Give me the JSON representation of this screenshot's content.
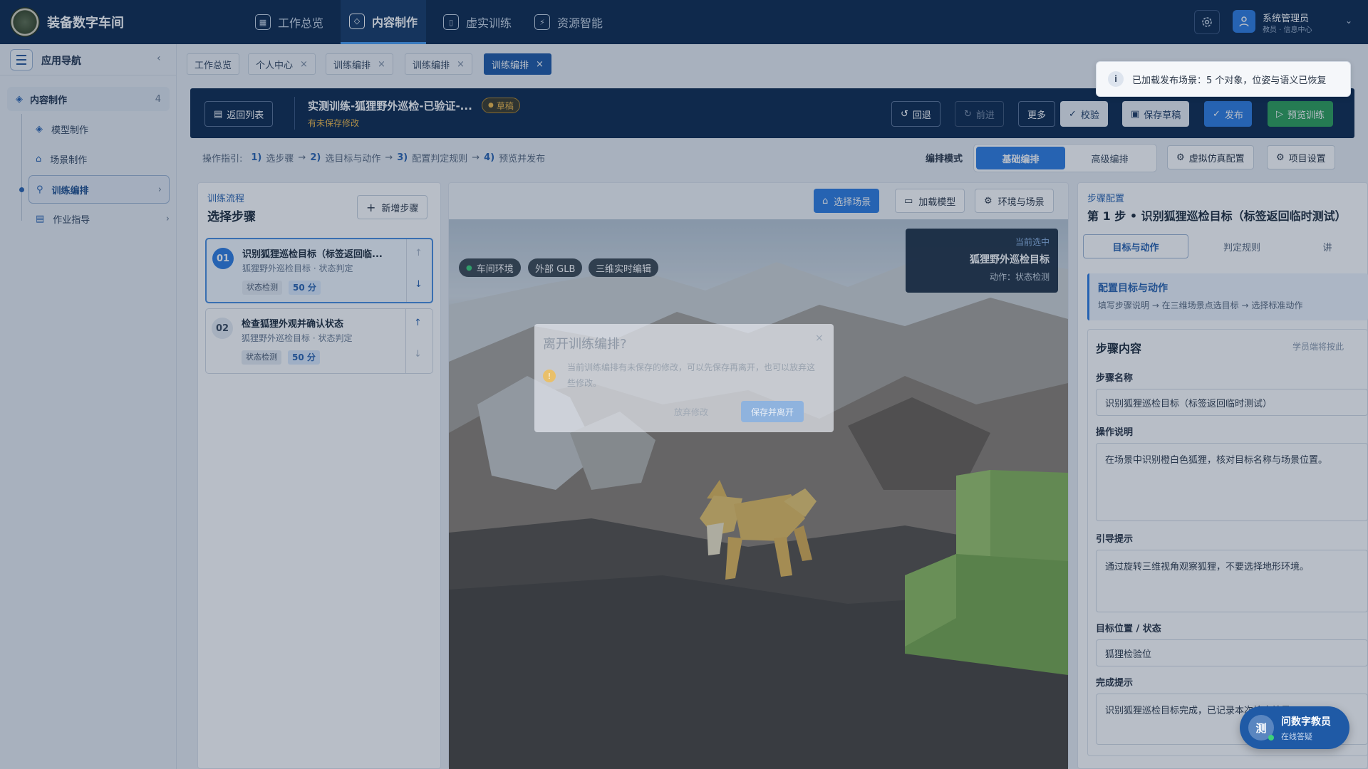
{
  "app": {
    "title": "装备数字车间"
  },
  "topnav": [
    {
      "label": "工作总览",
      "icon": "grid-icon"
    },
    {
      "label": "内容制作",
      "icon": "cube-icon"
    },
    {
      "label": "虚实训练",
      "icon": "book-icon"
    },
    {
      "label": "资源智能",
      "icon": "plug-icon"
    }
  ],
  "user": {
    "name": "系统管理员",
    "role": "教员 · 信息中心"
  },
  "sidebar": {
    "title": "应用导航",
    "group": {
      "label": "内容制作",
      "count": "4"
    },
    "items": [
      {
        "label": "模型制作",
        "icon": "cube-icon"
      },
      {
        "label": "场景制作",
        "icon": "scene-icon"
      },
      {
        "label": "训练编排",
        "icon": "flow-icon"
      },
      {
        "label": "作业指导",
        "icon": "doc-icon"
      }
    ]
  },
  "tabs": [
    {
      "label": "工作总览",
      "closable": false
    },
    {
      "label": "个人中心",
      "closable": true
    },
    {
      "label": "训练编排",
      "closable": true
    },
    {
      "label": "训练编排",
      "closable": true
    },
    {
      "label": "训练编排",
      "closable": true,
      "active": true
    }
  ],
  "toast": {
    "text": "已加载发布场景：5 个对象，位姿与语义已恢复"
  },
  "header": {
    "back_label": "返回列表",
    "title": "实测训练-狐狸野外巡检-已验证-...",
    "badge": "草稿",
    "unsaved": "有未保存修改",
    "undo": "回退",
    "redo": "前进",
    "more": "更多",
    "validate": "校验",
    "save": "保存草稿",
    "publish": "发布",
    "preview": "预览训练"
  },
  "guide": {
    "prefix": "操作指引:",
    "steps": [
      {
        "num": "1)",
        "text": "选步骤"
      },
      {
        "num": "2)",
        "text": "选目标与动作"
      },
      {
        "num": "3)",
        "text": "配置判定规则"
      },
      {
        "num": "4)",
        "text": "预览并发布"
      }
    ],
    "arrow": "→",
    "mode_label": "编排模式",
    "mode_basic": "基础编排",
    "mode_advanced": "高级编排",
    "vr_config": "虚拟仿真配置",
    "project_settings": "项目设置"
  },
  "flow": {
    "kicker": "训练流程",
    "title": "选择步骤",
    "add_label": "新增步骤",
    "steps": [
      {
        "num": "01",
        "title": "识别狐狸巡检目标（标签返回临...",
        "sub": "狐狸野外巡检目标 · 状态判定",
        "tag": "状态检测",
        "score": "50 分"
      },
      {
        "num": "02",
        "title": "检查狐狸外观并确认状态",
        "sub": "狐狸野外巡检目标 · 状态判定",
        "tag": "状态检测",
        "score": "50 分"
      }
    ]
  },
  "scene": {
    "select_scene": "选择场景",
    "load_model": "加载模型",
    "env_scene": "环境与场景",
    "chips": [
      "车间环境",
      "外部 GLB",
      "三维实时编辑"
    ],
    "selected_kicker": "当前选中",
    "selected_title": "狐狸野外巡检目标",
    "selected_action": "动作：状态检测"
  },
  "dialog": {
    "title": "离开训练编排?",
    "body": "当前训练编排有未保存的修改，可以先保存再离开，也可以放弃这些修改。",
    "discard": "放弃修改",
    "save_leave": "保存并离开"
  },
  "config": {
    "kicker": "步骤配置",
    "title": "第 1 步 • 识别狐狸巡检目标（标签返回临时测试）",
    "tabs": [
      "目标与动作",
      "判定规则",
      "讲"
    ],
    "hint_title": "配置目标与动作",
    "hint_text": "填写步骤说明 → 在三维场景点选目标 → 选择标准动作",
    "section": "步骤内容",
    "section_note": "学员端将按此",
    "fields": {
      "name_label": "步骤名称",
      "name": "识别狐狸巡检目标（标签返回临时测试）",
      "desc_label": "操作说明",
      "desc": "在场景中识别橙白色狐狸，核对目标名称与场景位置。",
      "hint_label": "引导提示",
      "hint": "通过旋转三维视角观察狐狸，不要选择地形环境。",
      "target_label": "目标位置 / 状态",
      "target": "狐狸检验位",
      "done_label": "完成提示",
      "done": "识别狐狸巡检目标完成，已记录本次检查结果。"
    }
  },
  "assistant": {
    "avatar": "测",
    "title": "问数字教员",
    "sub": "在线答疑"
  }
}
